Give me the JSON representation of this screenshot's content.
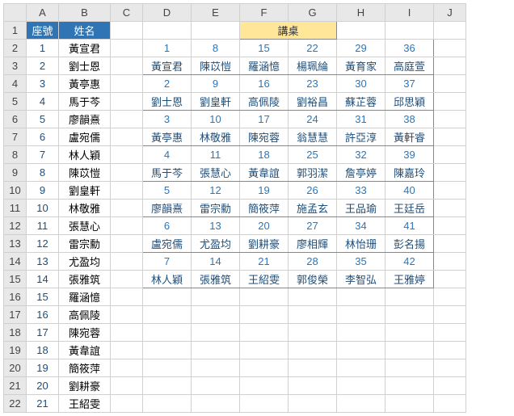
{
  "columns": [
    "A",
    "B",
    "C",
    "D",
    "E",
    "F",
    "G",
    "H",
    "I",
    "J"
  ],
  "rowCount": 22,
  "headers": {
    "seat": "座號",
    "name": "姓名"
  },
  "lectern": "講桌",
  "roster": [
    {
      "n": "1",
      "name": "黃宣君"
    },
    {
      "n": "2",
      "name": "劉士恩"
    },
    {
      "n": "3",
      "name": "黃亭惠"
    },
    {
      "n": "4",
      "name": "馬于芩"
    },
    {
      "n": "5",
      "name": "廖韻熹"
    },
    {
      "n": "6",
      "name": "盧宛儒"
    },
    {
      "n": "7",
      "name": "林人穎"
    },
    {
      "n": "8",
      "name": "陳苡愷"
    },
    {
      "n": "9",
      "name": "劉皇軒"
    },
    {
      "n": "10",
      "name": "林敬雅"
    },
    {
      "n": "11",
      "name": "張慧心"
    },
    {
      "n": "12",
      "name": "雷宗勳"
    },
    {
      "n": "13",
      "name": "尤盈均"
    },
    {
      "n": "14",
      "name": "張雅筑"
    },
    {
      "n": "15",
      "name": "羅涵憶"
    },
    {
      "n": "16",
      "name": "高佩陵"
    },
    {
      "n": "17",
      "name": "陳宛蓉"
    },
    {
      "n": "18",
      "name": "黃韋誼"
    },
    {
      "n": "19",
      "name": "簡筱萍"
    },
    {
      "n": "20",
      "name": "劉耕豪"
    },
    {
      "n": "21",
      "name": "王紹雯"
    }
  ],
  "seating_numbers": [
    [
      "1",
      "8",
      "15",
      "22",
      "29",
      "36"
    ],
    [
      "2",
      "9",
      "16",
      "23",
      "30",
      "37"
    ],
    [
      "3",
      "10",
      "17",
      "24",
      "31",
      "38"
    ],
    [
      "4",
      "11",
      "18",
      "25",
      "32",
      "39"
    ],
    [
      "5",
      "12",
      "19",
      "26",
      "33",
      "40"
    ],
    [
      "6",
      "13",
      "20",
      "27",
      "34",
      "41"
    ],
    [
      "7",
      "14",
      "21",
      "28",
      "35",
      "42"
    ]
  ],
  "seating_names": [
    [
      "黃宣君",
      "陳苡愷",
      "羅涵憶",
      "楊珮綸",
      "黃育家",
      "高庭萱"
    ],
    [
      "劉士恩",
      "劉皇軒",
      "高佩陵",
      "劉裕昌",
      "蘇芷蓉",
      "邱思穎"
    ],
    [
      "黃亭惠",
      "林敬雅",
      "陳宛蓉",
      "翁慧慧",
      "許亞淳",
      "黃軒睿"
    ],
    [
      "馬于芩",
      "張慧心",
      "黃韋誼",
      "郭羽潔",
      "詹亭婷",
      "陳嘉玲"
    ],
    [
      "廖韻熹",
      "雷宗勳",
      "簡筱萍",
      "施孟玄",
      "王品瑜",
      "王廷岳"
    ],
    [
      "盧宛儒",
      "尤盈均",
      "劉耕豪",
      "廖相輝",
      "林怡珊",
      "彭名揚"
    ],
    [
      "林人穎",
      "張雅筑",
      "王紹雯",
      "郭俊榮",
      "李智弘",
      "王雅婷"
    ]
  ]
}
